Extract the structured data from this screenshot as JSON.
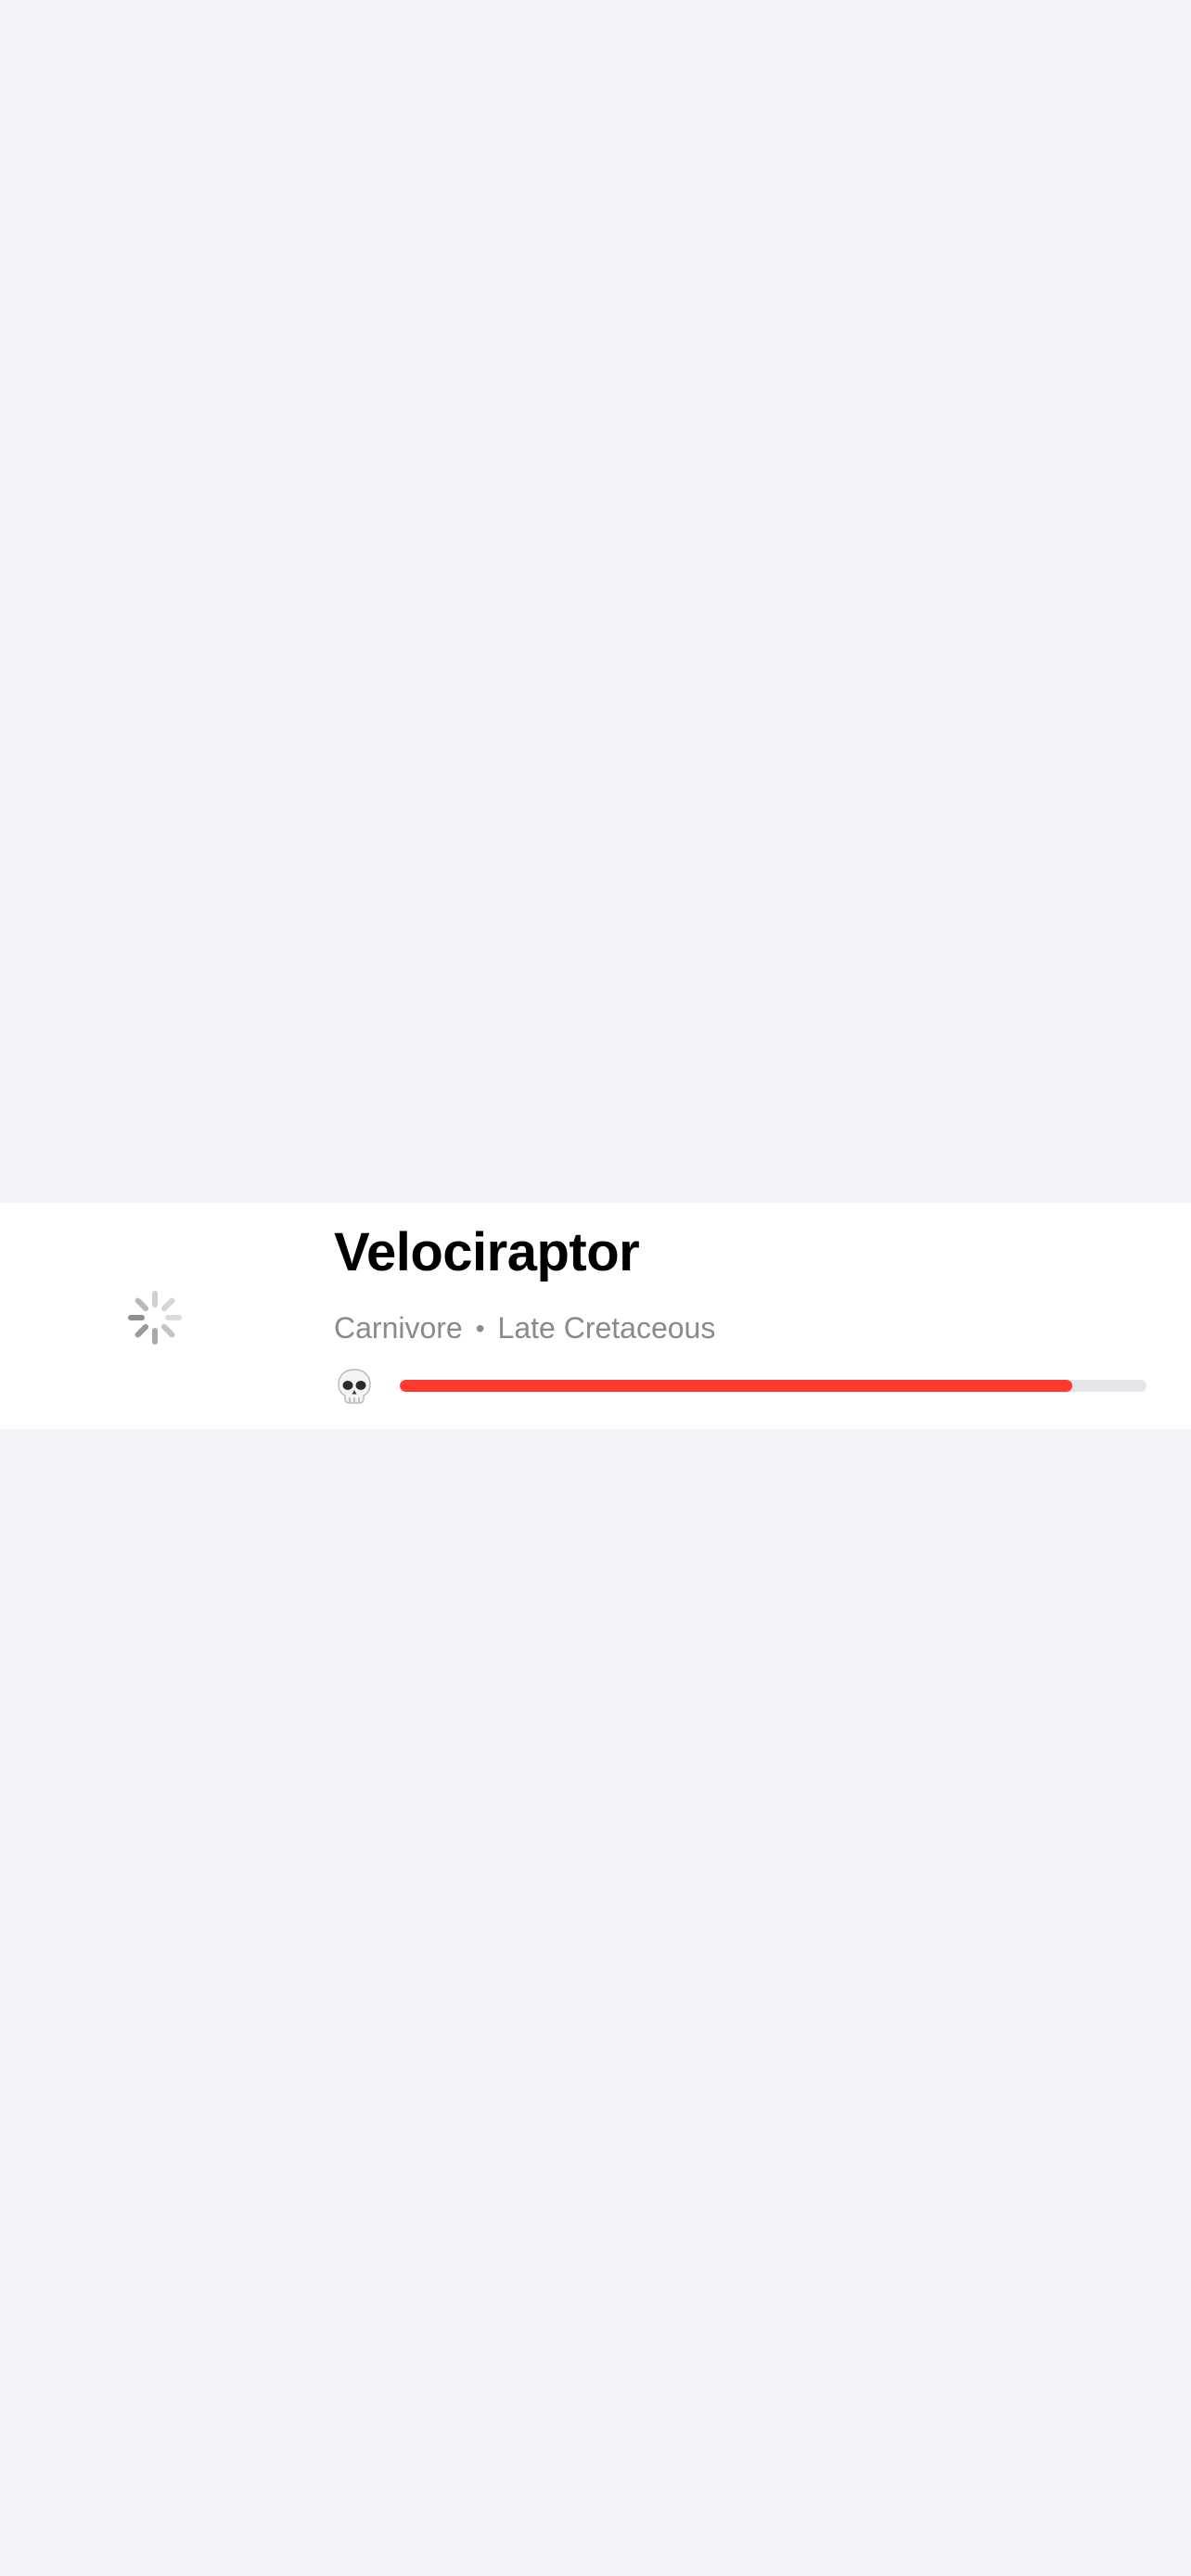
{
  "dinosaur": {
    "name": "Velociraptor",
    "diet": "Carnivore",
    "separator": "•",
    "period": "Late Cretaceous",
    "danger_icon": "skull-icon",
    "danger_level": 0.9,
    "image_state": "loading-spinner"
  },
  "colors": {
    "background": "#f2f2f7",
    "card": "#ffffff",
    "danger_fill": "#ff3b30",
    "danger_track": "#e5e5ea",
    "subtitle": "#8a8a8e"
  }
}
